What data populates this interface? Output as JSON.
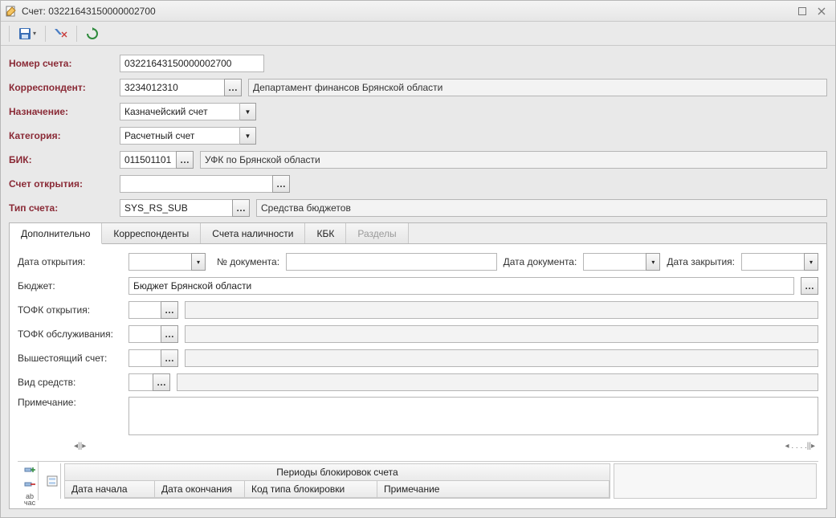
{
  "window": {
    "title": "Счет: 03221643150000002700"
  },
  "form": {
    "account_number": {
      "label": "Номер счета:",
      "value": "03221643150000002700"
    },
    "correspondent": {
      "label": "Корреспондент:",
      "code": "3234012310",
      "name": "Департамент финансов Брянской области"
    },
    "purpose": {
      "label": "Назначение:",
      "value": "Казначейский счет"
    },
    "category": {
      "label": "Категория:",
      "value": "Расчетный счет"
    },
    "bik": {
      "label": "БИК:",
      "code": "011501101",
      "name": "УФК по Брянской области"
    },
    "opening_account": {
      "label": "Счет открытия:",
      "value": ""
    },
    "account_type": {
      "label": "Тип счета:",
      "code": "SYS_RS_SUB",
      "name": "Средства бюджетов"
    }
  },
  "tabs": {
    "items": [
      {
        "label": "Дополнительно",
        "active": true
      },
      {
        "label": "Корреспонденты"
      },
      {
        "label": "Счета наличности"
      },
      {
        "label": "КБК"
      },
      {
        "label": "Разделы",
        "disabled": true
      }
    ]
  },
  "additional": {
    "open_date": {
      "label": "Дата открытия:",
      "value": ""
    },
    "doc_number": {
      "label": "№ документа:",
      "value": ""
    },
    "doc_date": {
      "label": "Дата документа:",
      "value": ""
    },
    "close_date": {
      "label": "Дата закрытия:",
      "value": ""
    },
    "budget": {
      "label": "Бюджет:",
      "value": "Бюджет Брянской области"
    },
    "tofk_open": {
      "label": "ТОФК открытия:",
      "code": "",
      "name": ""
    },
    "tofk_service": {
      "label": "ТОФК обслуживания:",
      "code": "",
      "name": ""
    },
    "parent_account": {
      "label": "Вышестоящий счет:",
      "code": "",
      "name": ""
    },
    "funds_type": {
      "label": "Вид средств:",
      "code": "",
      "name": ""
    },
    "notes": {
      "label": "Примечание:",
      "value": ""
    }
  },
  "grid": {
    "title": "Периоды блокировок счета",
    "columns": [
      "Дата начала",
      "Дата окончания",
      "Код типа блокировки",
      "Примечание"
    ]
  },
  "scroll": {
    "left": "◂||▸",
    "right": "◂ . . . .||▸"
  }
}
